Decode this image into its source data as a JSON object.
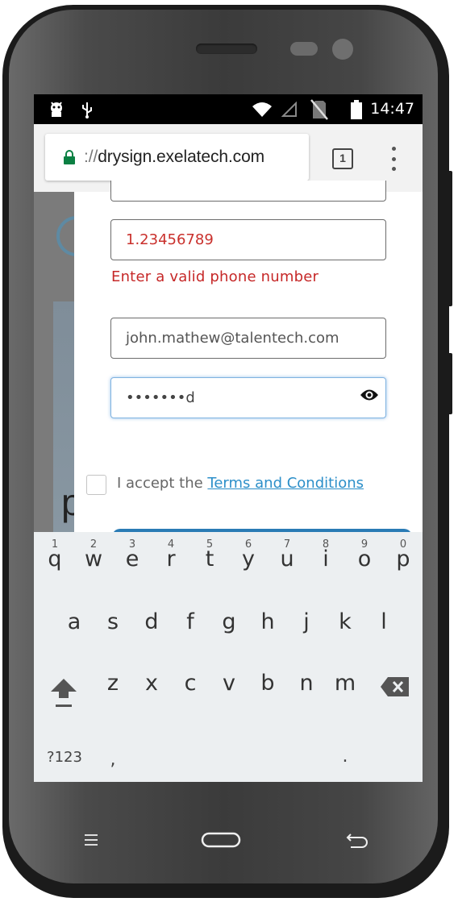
{
  "statusbar": {
    "time": "14:47",
    "icons": [
      "android-debug-icon",
      "usb-icon",
      "wifi-icon",
      "signal-icon",
      "no-sim-icon",
      "battery-icon"
    ]
  },
  "browser": {
    "url_dim": "://",
    "url_host": "drysign.exelatech.com",
    "tab_count": "1"
  },
  "form": {
    "phone_value": "1.23456789",
    "phone_error": "Enter a valid phone number",
    "email_value": "john.mathew@talentech.com",
    "password_value": "•••••••d",
    "terms_prefix": "I accept the ",
    "terms_link": "Terms and Conditions",
    "error_color": "#c62828",
    "link_color": "#2c8fc9"
  },
  "keyboard": {
    "row1": [
      {
        "hint": "1",
        "key": "q"
      },
      {
        "hint": "2",
        "key": "w"
      },
      {
        "hint": "3",
        "key": "e"
      },
      {
        "hint": "4",
        "key": "r"
      },
      {
        "hint": "5",
        "key": "t"
      },
      {
        "hint": "6",
        "key": "y"
      },
      {
        "hint": "7",
        "key": "u"
      },
      {
        "hint": "8",
        "key": "i"
      },
      {
        "hint": "9",
        "key": "o"
      },
      {
        "hint": "0",
        "key": "p"
      }
    ],
    "row2": [
      "a",
      "s",
      "d",
      "f",
      "g",
      "h",
      "j",
      "k",
      "l"
    ],
    "row3": [
      "z",
      "x",
      "c",
      "v",
      "b",
      "n",
      "m"
    ],
    "symbols_label": "?123",
    "comma": ",",
    "period": ".",
    "enter_color": "#26a69a"
  },
  "hardware_nav": [
    "menu-icon",
    "home-icon",
    "back-icon"
  ]
}
